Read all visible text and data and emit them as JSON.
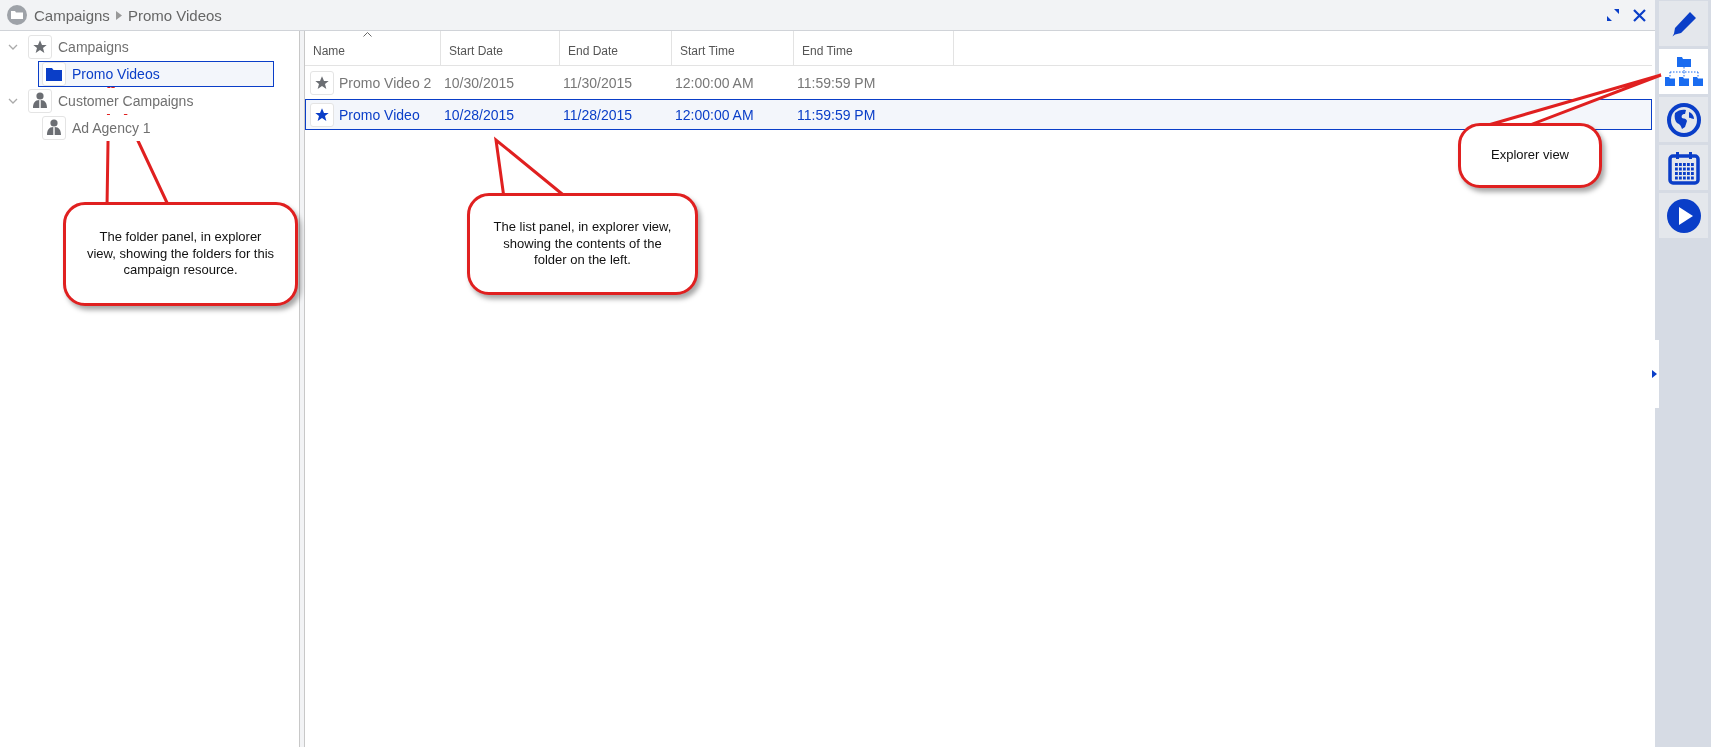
{
  "breadcrumb": [
    "Campaigns",
    "Promo Videos"
  ],
  "tree": [
    {
      "label": "Campaigns",
      "kind": "star",
      "expanded": true,
      "selected": false,
      "children": [
        {
          "label": "Promo Videos",
          "kind": "folder",
          "selected": true
        }
      ]
    },
    {
      "label": "Customer Campaigns",
      "kind": "people",
      "expanded": true,
      "selected": false,
      "children": [
        {
          "label": "Ad Agency 1",
          "kind": "people",
          "selected": false
        }
      ]
    }
  ],
  "list": {
    "columns": [
      {
        "label": "Name",
        "sorted": true
      },
      {
        "label": "Start Date",
        "sorted": false
      },
      {
        "label": "End Date",
        "sorted": false
      },
      {
        "label": "Start Time",
        "sorted": false
      },
      {
        "label": "End Time",
        "sorted": false
      }
    ],
    "rows": [
      {
        "cells": [
          "Promo Video 2",
          "10/30/2015",
          "11/30/2015",
          "12:00:00 AM",
          "11:59:59 PM"
        ],
        "selected": false
      },
      {
        "cells": [
          "Promo Video",
          "10/28/2015",
          "11/28/2015",
          "12:00:00 AM",
          "11:59:59 PM"
        ],
        "selected": true
      }
    ]
  },
  "toolbar": [
    {
      "kind": "edit",
      "selected": false
    },
    {
      "kind": "explorer",
      "selected": true
    },
    {
      "kind": "globe",
      "selected": false
    },
    {
      "kind": "calendar",
      "selected": false
    },
    {
      "kind": "play",
      "selected": false
    }
  ],
  "callouts": [
    {
      "text": "The folder panel, in explorer view, showing the folders for this campaign resource."
    },
    {
      "text": "The list panel, in explorer view, showing the contents of the folder on the left."
    },
    {
      "text": "Explorer view"
    }
  ]
}
